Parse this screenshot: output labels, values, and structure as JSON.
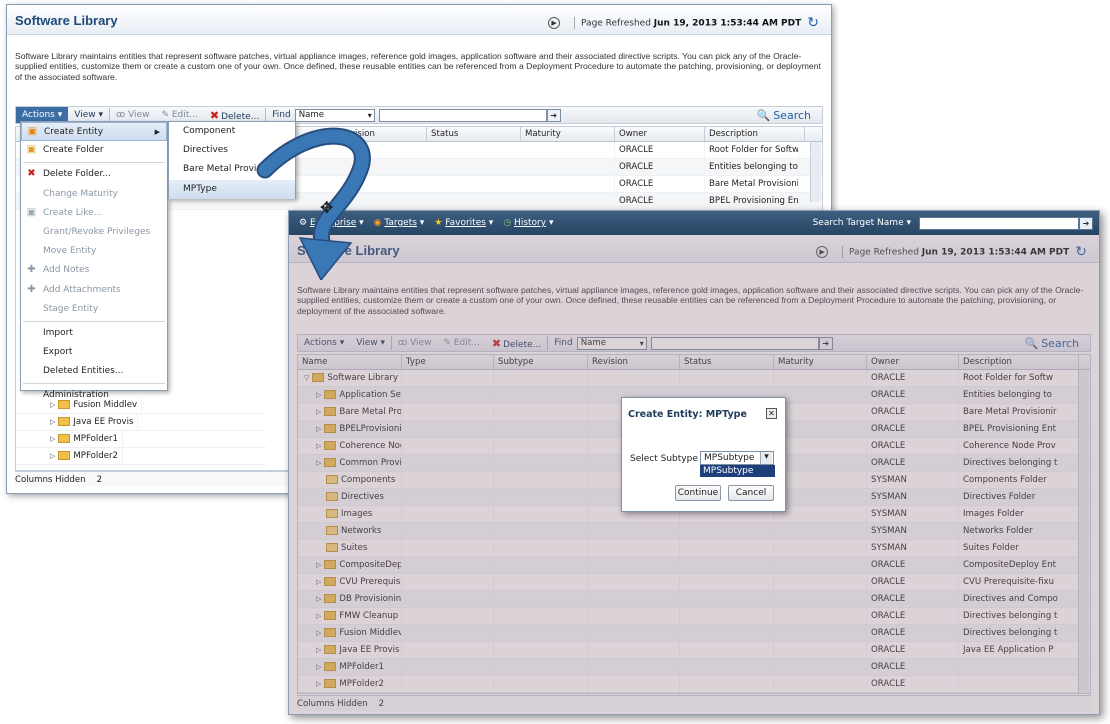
{
  "windowA": {
    "page_title": "Software Library",
    "refreshed_label": "Page Refreshed",
    "refreshed_time": "Jun 19, 2013 1:53:44 AM PDT",
    "description": "Software Library maintains entities that represent software patches, virtual appliance images, reference gold images, application software and their associated directive scripts. You can pick any of the Oracle-supplied entities, customize them or create a custom one of your own. Once defined, these reusable entities can be referenced from a Deployment Procedure to automate the patching, provisioning, or deployment of the associated software.",
    "toolbar": {
      "actions": "Actions",
      "view": "View",
      "view_btn": "View",
      "edit": "Edit...",
      "delete": "Delete...",
      "find": "Find",
      "find_field": "Name",
      "search": "Search"
    },
    "columns": [
      "Revision",
      "Status",
      "Maturity",
      "Owner",
      "Description"
    ],
    "rows": [
      {
        "owner": "ORACLE",
        "description": "Root Folder for Softw"
      },
      {
        "owner": "ORACLE",
        "description": "Entities belonging to"
      },
      {
        "owner": "ORACLE",
        "description": "Bare Metal Provisionir"
      },
      {
        "owner": "ORACLE",
        "description": "BPEL Provisioning Ent"
      }
    ],
    "tree_visible": [
      "Fusion Middlev",
      "Java EE Provis",
      "MPFolder1",
      "MPFolder2"
    ],
    "footer": {
      "label": "Columns Hidden",
      "count": "2"
    },
    "actions_menu": [
      {
        "label": "Create Entity",
        "state": "highlight",
        "icon": "create-entity-icon"
      },
      {
        "label": "Create Folder",
        "state": "normal",
        "icon": "create-folder-icon"
      },
      {
        "label": "Delete Folder...",
        "state": "normal",
        "icon": "delete-icon"
      },
      {
        "label": "Change Maturity",
        "state": "disabled",
        "icon": ""
      },
      {
        "label": "Create Like...",
        "state": "disabled",
        "icon": "create-like-icon"
      },
      {
        "label": "Grant/Revoke Privileges",
        "state": "disabled",
        "icon": ""
      },
      {
        "label": "Move Entity",
        "state": "disabled",
        "icon": ""
      },
      {
        "label": "Add Notes",
        "state": "disabled",
        "icon": "add-notes-icon"
      },
      {
        "label": "Add Attachments",
        "state": "disabled",
        "icon": "add-attachments-icon"
      },
      {
        "label": "Stage Entity",
        "state": "disabled",
        "icon": ""
      },
      {
        "label": "Import",
        "state": "normal",
        "icon": ""
      },
      {
        "label": "Export",
        "state": "normal",
        "icon": ""
      },
      {
        "label": "Deleted Entities...",
        "state": "normal",
        "icon": ""
      },
      {
        "label": "Administration",
        "state": "normal",
        "icon": ""
      }
    ],
    "create_entity_submenu": [
      "Component",
      "Directives",
      "Bare Metal Provi",
      "MPType"
    ]
  },
  "windowB": {
    "nav": {
      "enterprise": "Enterprise",
      "targets": "Targets",
      "favorites": "Favorites",
      "history": "History",
      "search_target": "Search Target Name"
    },
    "page_title": "Software Library",
    "refreshed_label": "Page Refreshed",
    "refreshed_time": "Jun 19, 2013 1:53:44 AM PDT",
    "description": "Software Library maintains entities that represent software patches, virtual appliance images, reference gold images, application software and their associated directive scripts. You can pick any of the Oracle-supplied entities, customize them or create a custom one of your own. Once defined, these reusable entities can be referenced from a Deployment Procedure to automate the patching, provisioning, or deployment of the associated software.",
    "toolbar": {
      "actions": "Actions",
      "view": "View",
      "view_btn": "View",
      "edit": "Edit...",
      "delete": "Delete...",
      "find": "Find",
      "find_field": "Name",
      "search": "Search"
    },
    "columns": [
      "Name",
      "Type",
      "Subtype",
      "Revision",
      "Status",
      "Maturity",
      "Owner",
      "Description"
    ],
    "rows": [
      {
        "name": "Software Library",
        "level": 0,
        "kind": "folder",
        "expand": "open",
        "owner": "ORACLE",
        "description": "Root Folder for Softw"
      },
      {
        "name": "Application Ser",
        "level": 1,
        "kind": "folder",
        "expand": "closed",
        "owner": "ORACLE",
        "description": "Entities belonging to"
      },
      {
        "name": "Bare Metal Pro",
        "level": 1,
        "kind": "folder",
        "expand": "closed",
        "owner": "ORACLE",
        "description": "Bare Metal Provisionir"
      },
      {
        "name": "BPELProvisioni",
        "level": 1,
        "kind": "folder",
        "expand": "closed",
        "owner": "ORACLE",
        "description": "BPEL Provisioning Ent"
      },
      {
        "name": "Coherence Nod",
        "level": 1,
        "kind": "folder",
        "expand": "closed",
        "owner": "ORACLE",
        "description": "Coherence Node Prov"
      },
      {
        "name": "Common Provis",
        "level": 1,
        "kind": "folder",
        "expand": "closed",
        "owner": "ORACLE",
        "description": "Directives belonging t"
      },
      {
        "name": "Components",
        "level": 1,
        "kind": "plain",
        "expand": "none",
        "owner": "SYSMAN",
        "description": "Components Folder"
      },
      {
        "name": "Directives",
        "level": 1,
        "kind": "plain",
        "expand": "none",
        "owner": "SYSMAN",
        "description": "Directives Folder"
      },
      {
        "name": "Images",
        "level": 1,
        "kind": "plain",
        "expand": "none",
        "owner": "SYSMAN",
        "description": "Images Folder"
      },
      {
        "name": "Networks",
        "level": 1,
        "kind": "plain",
        "expand": "none",
        "owner": "SYSMAN",
        "description": "Networks Folder"
      },
      {
        "name": "Suites",
        "level": 1,
        "kind": "plain",
        "expand": "none",
        "owner": "SYSMAN",
        "description": "Suites Folder"
      },
      {
        "name": "CompositeDep",
        "level": 1,
        "kind": "folder",
        "expand": "closed",
        "owner": "ORACLE",
        "description": "CompositeDeploy Ent"
      },
      {
        "name": "CVU Prerequisi",
        "level": 1,
        "kind": "folder",
        "expand": "closed",
        "owner": "ORACLE",
        "description": "CVU Prerequisite-fixu"
      },
      {
        "name": "DB Provisioning",
        "level": 1,
        "kind": "folder",
        "expand": "closed",
        "owner": "ORACLE",
        "description": "Directives and Compo"
      },
      {
        "name": "FMW Cleanup",
        "level": 1,
        "kind": "folder",
        "expand": "closed",
        "owner": "ORACLE",
        "description": "Directives belonging t"
      },
      {
        "name": "Fusion Middlev",
        "level": 1,
        "kind": "folder",
        "expand": "closed",
        "owner": "ORACLE",
        "description": "Directives belonging t"
      },
      {
        "name": "Java EE Provis",
        "level": 1,
        "kind": "folder",
        "expand": "closed",
        "owner": "ORACLE",
        "description": "Java EE Application P"
      },
      {
        "name": "MPFolder1",
        "level": 1,
        "kind": "folder",
        "expand": "closed",
        "owner": "ORACLE",
        "description": ""
      },
      {
        "name": "MPFolder2",
        "level": 1,
        "kind": "folder",
        "expand": "closed",
        "owner": "ORACLE",
        "description": ""
      }
    ],
    "footer": {
      "label": "Columns Hidden",
      "count": "2"
    },
    "dialog": {
      "title": "Create Entity: MPType",
      "label": "Select Subtype",
      "value": "MPSubtype",
      "option": "MPSubtype",
      "continue": "Continue",
      "cancel": "Cancel"
    }
  },
  "colors": {
    "title_blue": "#1f4a78",
    "nav_blue": "#274563",
    "arrow_blue": "#3a78b5",
    "highlight": "#1d3f7a",
    "delete_red": "#c8201a"
  }
}
